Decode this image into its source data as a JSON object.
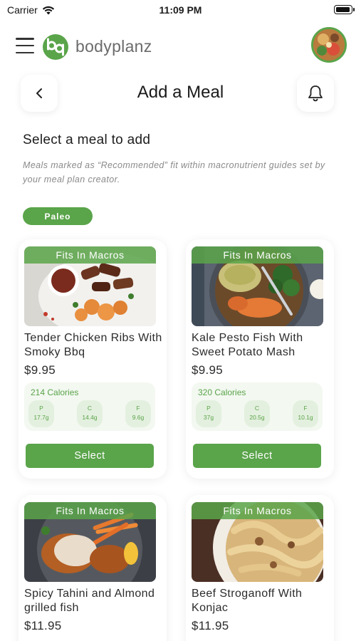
{
  "status_bar": {
    "carrier": "Carrier",
    "time": "11:09 PM"
  },
  "header": {
    "brand": "bodyplanz",
    "logo_letters": "bp"
  },
  "title_row": {
    "title": "Add a Meal"
  },
  "section": {
    "title": "Select a meal to add",
    "hint": "Meals marked as “Recommended” fit within macronutrient guides set by your meal plan creator."
  },
  "filter": {
    "label": "Paleo"
  },
  "colors": {
    "accent": "#5aa44a",
    "accent_light": "#e4f0df",
    "macro_bg": "#f3f8f1"
  },
  "meals": [
    {
      "badge": "Fits In Macros",
      "name": "Tender Chicken Ribs With Smoky Bbq",
      "price": "$9.95",
      "calories": "214 Calories",
      "protein_label": "P",
      "protein": "17.7g",
      "carbs_label": "C",
      "carbs": "14.4g",
      "fat_label": "F",
      "fat": "9.6g",
      "select_label": "Select"
    },
    {
      "badge": "Fits In Macros",
      "name": "Kale Pesto Fish With Sweet Potato Mash",
      "price": "$9.95",
      "calories": "320 Calories",
      "protein_label": "P",
      "protein": "37g",
      "carbs_label": "C",
      "carbs": "20.5g",
      "fat_label": "F",
      "fat": "10.1g",
      "select_label": "Select"
    },
    {
      "badge": "Fits In Macros",
      "name": "Spicy Tahini and Almond grilled fish",
      "price": "$11.95"
    },
    {
      "badge": "Fits In Macros",
      "name": "Beef Stroganoff With Konjac",
      "price": "$11.95"
    }
  ]
}
